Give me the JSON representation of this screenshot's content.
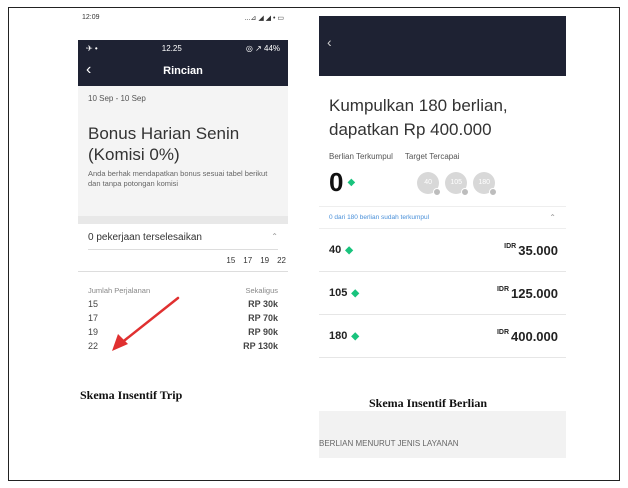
{
  "left": {
    "outer_time": "12:09",
    "outer_icons": "...⊿ ◢ ◢ • ▭",
    "inner_status": {
      "left": "✈ •",
      "time": "12.25",
      "right": "◎ ↗ 44%"
    },
    "nav_title": "Rincian",
    "date": "10 Sep - 10 Sep",
    "bonus_title": "Bonus Harian Senin (Komisi 0%)",
    "bonus_desc": "Anda berhak mendapatkan bonus sesuai tabel berikut dan tanpa potongan komisi",
    "jobs_label": "0 pekerjaan terselesaikan",
    "ticks": [
      "15",
      "17",
      "19",
      "22"
    ],
    "table_headers": {
      "left": "Jumlah Perjalanan",
      "right": "Sekaligus"
    },
    "rows": [
      {
        "trips": "15",
        "amount": "RP 30k"
      },
      {
        "trips": "17",
        "amount": "RP 70k"
      },
      {
        "trips": "19",
        "amount": "RP 90k"
      },
      {
        "trips": "22",
        "amount": "RP 130k"
      }
    ],
    "caption": "Skema Insentif Trip"
  },
  "right": {
    "title": "Kumpulkan 180 berlian, dapatkan Rp 400.000",
    "label_collected": "Berlian Terkumpul",
    "label_target": "Target Tercapai",
    "collected": "0",
    "badges": [
      "40",
      "105",
      "180"
    ],
    "progress_text": "0 dari 180 berlian sudah terkumpul",
    "rows": [
      {
        "level": "40",
        "currency": "IDR",
        "amount": "35.000"
      },
      {
        "level": "105",
        "currency": "IDR",
        "amount": "125.000"
      },
      {
        "level": "180",
        "currency": "IDR",
        "amount": "400.000"
      }
    ],
    "caption": "Skema Insentif Berlian",
    "bottom_label": "BERLIAN MENURUT JENIS LAYANAN"
  },
  "colors": {
    "nav_bg": "#1e2233",
    "gem": "#19c37d",
    "arrow": "#e03030",
    "link": "#4a90d9"
  }
}
